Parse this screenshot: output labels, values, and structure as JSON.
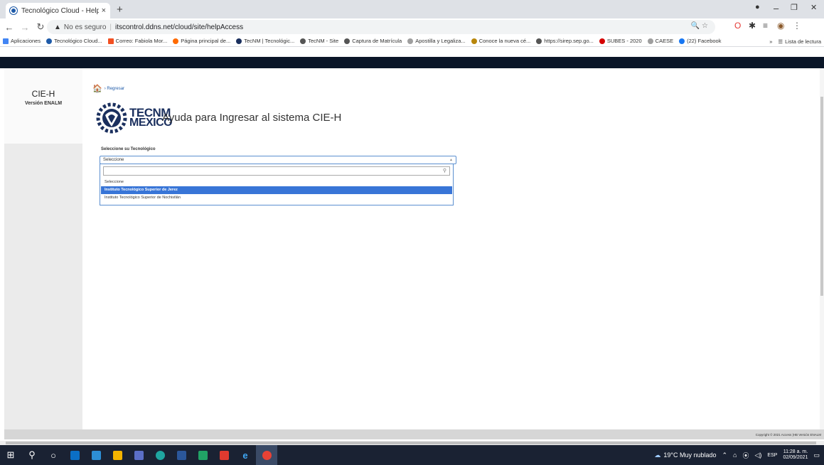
{
  "browser": {
    "tab_title": "Tecnológico Cloud - HelpAccess",
    "tab_close": "×",
    "new_tab": "+",
    "security_label": "No es seguro",
    "url": "itscontrol.ddns.net/cloud/site/helpAccess",
    "window_controls": {
      "minimize": "–",
      "restore": "❐",
      "close": "✕"
    }
  },
  "bookmarks": [
    {
      "label": "Aplicaciones",
      "color": "#4285f4"
    },
    {
      "label": "Tecnológico Cloud...",
      "color": "#1e5aa8"
    },
    {
      "label": "Correo: Fabiola Mor...",
      "color": "#f25022"
    },
    {
      "label": "Página principal de...",
      "color": "#ff6a00"
    },
    {
      "label": "TecNM | Tecnológic...",
      "color": "#1a2f5e"
    },
    {
      "label": "TecNM - Site",
      "color": "#555555"
    },
    {
      "label": "Captura de Matrícula",
      "color": "#555555"
    },
    {
      "label": "Apostilla y Legaliza...",
      "color": "#9e9e9e"
    },
    {
      "label": "Conoce la nueva cé...",
      "color": "#b8860b"
    },
    {
      "label": "https://sirep.sep.go...",
      "color": "#555555"
    },
    {
      "label": "SUBES - 2020",
      "color": "#d50000"
    },
    {
      "label": "CAESE",
      "color": "#9e9e9e"
    },
    {
      "label": "(22) Facebook",
      "color": "#1877f2"
    }
  ],
  "bookmarks_more": "»",
  "reading_list": "Lista de lectura",
  "sidebar": {
    "app_name": "CIE-H",
    "version": "Versión ENALM"
  },
  "breadcrumb": {
    "back_label": "› Regresar"
  },
  "brand": {
    "line1": "TECNM",
    "line2": "MEXICO"
  },
  "page": {
    "heading": "Ayuda para Ingresar al sistema CIE-H"
  },
  "select": {
    "label": "Seleccione su Tecnológico",
    "current_value": "Seleccione",
    "search_value": "",
    "options": [
      "Seleccione",
      "Instituto Tecnológico Superior de Jerez",
      "Instituto Tecnológico Superior de Nochistlán"
    ],
    "highlighted_index": 1
  },
  "footer": {
    "copyright": "Copyright © 2021 Access |HB Versión ENALM"
  },
  "taskbar": {
    "weather": "19°C Muy nublado",
    "language": "ESP",
    "time": "11:28 a. m.",
    "date": "02/09/2021"
  }
}
